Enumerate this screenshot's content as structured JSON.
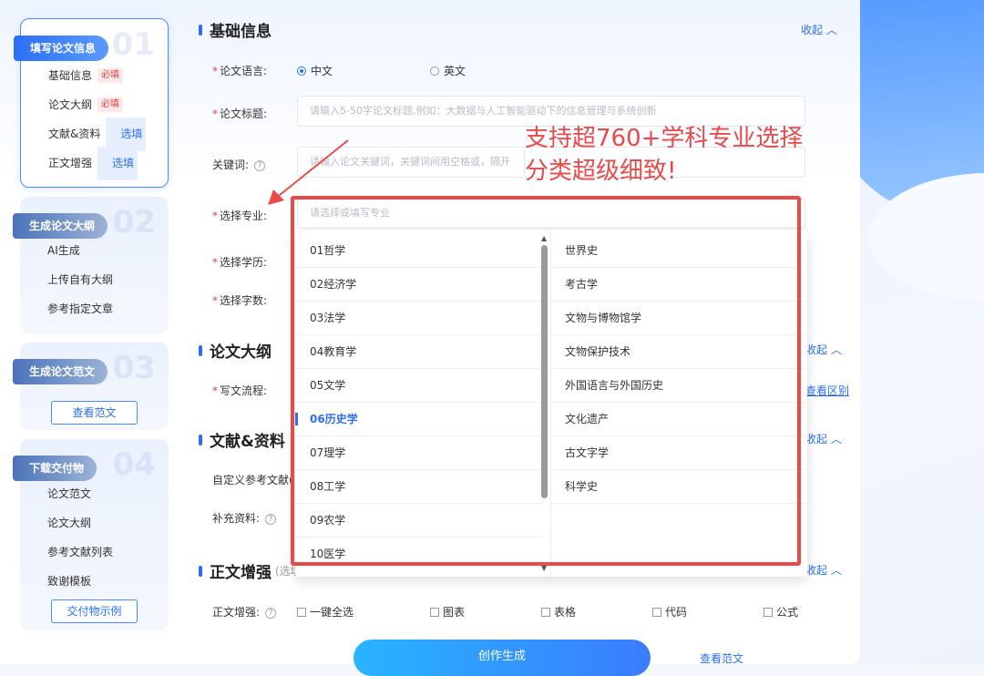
{
  "sidebar": {
    "steps": [
      {
        "tag": "填写论文信息",
        "num": "01",
        "items": [
          {
            "label": "基础信息",
            "badge": "必填"
          },
          {
            "label": "论文大纲",
            "badge": "必填"
          },
          {
            "label": "文献&资料",
            "badge": "选填"
          },
          {
            "label": "正文增强",
            "badge": "选填"
          }
        ]
      },
      {
        "tag": "生成论文大纲",
        "num": "02",
        "items": [
          {
            "label": "AI生成"
          },
          {
            "label": "上传自有大纲"
          },
          {
            "label": "参考指定文章"
          }
        ]
      },
      {
        "tag": "生成论文范文",
        "num": "03",
        "button": "查看范文"
      },
      {
        "tag": "下载交付物",
        "num": "04",
        "items": [
          {
            "label": "论文范文"
          },
          {
            "label": "论文大纲"
          },
          {
            "label": "参考文献列表"
          },
          {
            "label": "致谢模板"
          }
        ],
        "button": "交付物示例"
      }
    ]
  },
  "basic": {
    "title": "基础信息",
    "collapse": "收起",
    "language_label": "论文语言:",
    "lang_options": [
      "中文",
      "英文"
    ],
    "title_label": "论文标题:",
    "title_placeholder": "请输入5-50字论文标题,例如：大数据与人工智能驱动下的信息管理与系统创新",
    "keywords_label": "关键词:",
    "keywords_placeholder": "请输入论文关键词，关键词间用空格或，隔开",
    "major_label": "选择专业:",
    "major_placeholder": "请选择或填写专业",
    "degree_label": "选择学历:",
    "words_label": "选择字数:"
  },
  "outline": {
    "title": "论文大纲",
    "collapse": "收起",
    "flow_label": "写文流程:",
    "diff_link": "查看区别"
  },
  "refs": {
    "title": "文献&资料",
    "collapse": "收起",
    "custom_label": "自定义参考文献(",
    "extra_label": "补充资料:"
  },
  "enhance": {
    "title": "正文增强",
    "sub": "(选填",
    "collapse": "收起",
    "label": "正文增强:",
    "options": [
      "一键全选",
      "图表",
      "表格",
      "代码",
      "公式"
    ]
  },
  "dropdown": {
    "categories": [
      "01哲学",
      "02经济学",
      "03法学",
      "04教育学",
      "05文学",
      "06历史学",
      "07理学",
      "08工学",
      "09农学",
      "10医学"
    ],
    "selected": "06历史学",
    "subjects": [
      "世界史",
      "考古学",
      "文物与博物馆学",
      "文物保护技术",
      "外国语言与外国历史",
      "文化遗产",
      "古文字学",
      "科学史"
    ]
  },
  "promo": {
    "line1": "支持超760+学科专业选择",
    "line2": "分类超级细致!"
  },
  "actions": {
    "generate": "创作生成",
    "view_sample": "查看范文"
  },
  "colors": {
    "accent": "#2b6ef5",
    "promo_red": "#e84a4a",
    "required_red": "#ee3b3b"
  }
}
